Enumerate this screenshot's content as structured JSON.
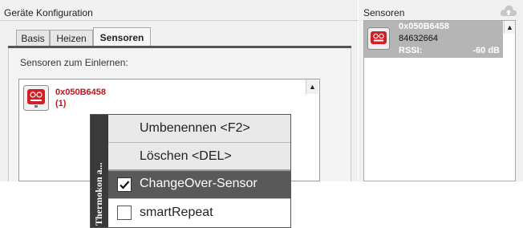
{
  "left_panel": {
    "title": "Geräte Konfiguration",
    "tabs": [
      {
        "label": "Basis"
      },
      {
        "label": "Heizen"
      },
      {
        "label": "Sensoren",
        "active": true
      }
    ],
    "learn_label": "Sensoren zum Einlernen:",
    "learn_list": [
      {
        "id": "0x050B6458",
        "index": "(1)",
        "icon": "sensor-device-icon"
      }
    ]
  },
  "right_panel": {
    "title": "Sensoren",
    "header_icon": "cloud-icon",
    "items": [
      {
        "id": "0x050B6458",
        "number": "84632664",
        "rssi_label": "RSSI:",
        "rssi_value": "-60 dB",
        "icon": "sensor-device-icon"
      }
    ]
  },
  "context_menu": {
    "side_label": "Thermokon a...",
    "items": [
      {
        "label": "Umbenennen <F2>"
      },
      {
        "label": "Löschen <DEL>"
      },
      {
        "label": "ChangeOver-Sensor",
        "checked": true
      },
      {
        "label": "smartRepeat",
        "checked": false
      }
    ]
  },
  "colors": {
    "accent_red": "#c0161b",
    "selected_item": "#b5b5b5",
    "menu_highlight": "#595959"
  }
}
